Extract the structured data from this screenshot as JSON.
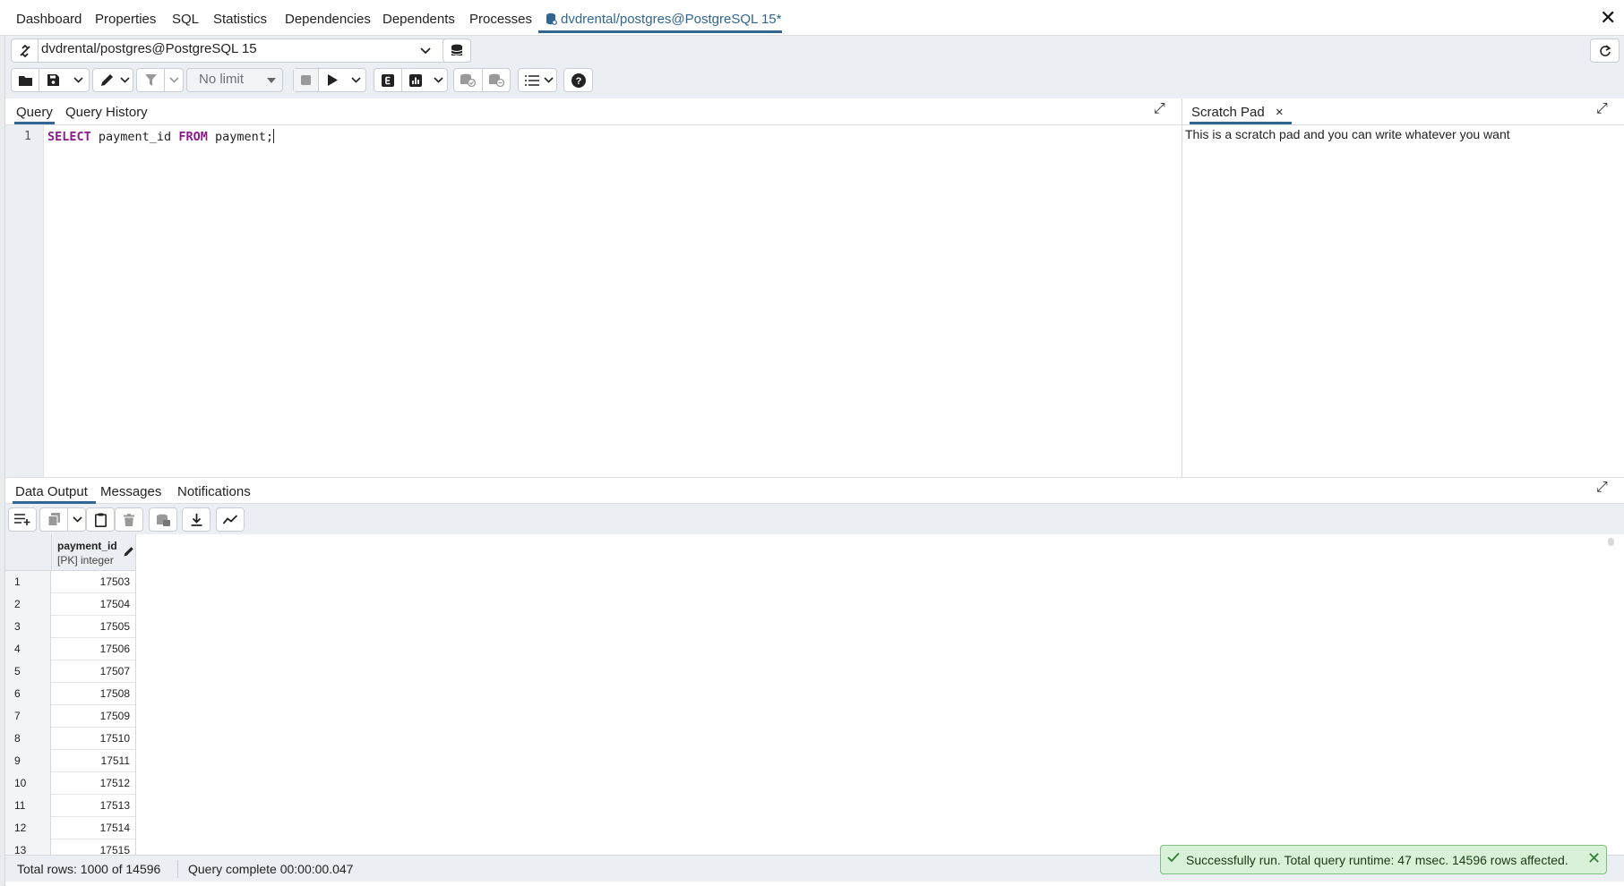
{
  "top_tabs": [
    "Dashboard",
    "Properties",
    "SQL",
    "Statistics",
    "Dependencies",
    "Dependents",
    "Processes"
  ],
  "active_tab": "dvdrental/postgres@PostgreSQL 15*",
  "connection": {
    "label": "dvdrental/postgres@PostgreSQL 15"
  },
  "toolbar": {
    "row_limit": "No limit"
  },
  "query_panel": {
    "tabs": [
      "Query",
      "Query History"
    ],
    "line_number": "1",
    "sql": {
      "kw1": "SELECT",
      "part1": " payment_id ",
      "kw2": "FROM",
      "part2": " payment;"
    }
  },
  "scratch_pad": {
    "title": "Scratch Pad",
    "close": "×",
    "text": "This is a scratch pad and you can write whatever you want"
  },
  "output_panel": {
    "tabs": [
      "Data Output",
      "Messages",
      "Notifications"
    ]
  },
  "grid": {
    "column": {
      "name": "payment_id",
      "type": "[PK] integer"
    },
    "rows": [
      {
        "n": "1",
        "v": "17503"
      },
      {
        "n": "2",
        "v": "17504"
      },
      {
        "n": "3",
        "v": "17505"
      },
      {
        "n": "4",
        "v": "17506"
      },
      {
        "n": "5",
        "v": "17507"
      },
      {
        "n": "6",
        "v": "17508"
      },
      {
        "n": "7",
        "v": "17509"
      },
      {
        "n": "8",
        "v": "17510"
      },
      {
        "n": "9",
        "v": "17511"
      },
      {
        "n": "10",
        "v": "17512"
      },
      {
        "n": "11",
        "v": "17513"
      },
      {
        "n": "12",
        "v": "17514"
      },
      {
        "n": "13",
        "v": "17515"
      }
    ]
  },
  "status": {
    "total_rows": "Total rows: 1000 of 14596",
    "query_status": "Query complete 00:00:00.047"
  },
  "toast": {
    "message": "Successfully run. Total query runtime: 47 msec. 14596 rows affected."
  },
  "colors": {
    "accent": "#326690",
    "toolbar_bg": "#ebeef3",
    "success_bg": "#d9f0d9"
  }
}
